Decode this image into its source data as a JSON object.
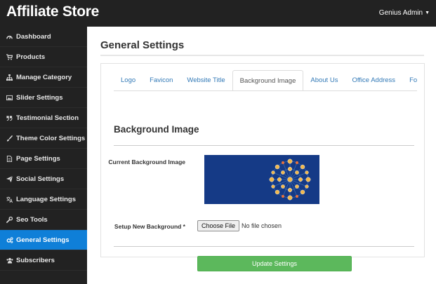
{
  "app": {
    "brand": "Affiliate Store",
    "user": "Genius Admin"
  },
  "sidebar": {
    "items": [
      {
        "label": "Dashboard",
        "icon": "dashboard-icon"
      },
      {
        "label": "Products",
        "icon": "cart-icon"
      },
      {
        "label": "Manage Category",
        "icon": "sitemap-icon"
      },
      {
        "label": "Slider Settings",
        "icon": "image-icon"
      },
      {
        "label": "Testimonial Section",
        "icon": "quote-icon"
      },
      {
        "label": "Theme Color Settings",
        "icon": "paint-brush-icon"
      },
      {
        "label": "Page Settings",
        "icon": "file-icon"
      },
      {
        "label": "Social Settings",
        "icon": "paper-plane-icon"
      },
      {
        "label": "Language Settings",
        "icon": "language-icon"
      },
      {
        "label": "Seo Tools",
        "icon": "wrench-icon"
      },
      {
        "label": "General Settings",
        "icon": "gears-icon",
        "active": true
      },
      {
        "label": "Subscribers",
        "icon": "users-icon"
      }
    ]
  },
  "main": {
    "title": "General Settings",
    "tabs": [
      {
        "label": "Logo"
      },
      {
        "label": "Favicon"
      },
      {
        "label": "Website Title"
      },
      {
        "label": "Background Image",
        "active": true
      },
      {
        "label": "About Us"
      },
      {
        "label": "Office Address"
      },
      {
        "label": "Footer"
      }
    ],
    "section_title": "Background Image",
    "current_bg_label": "Current Background Image",
    "new_bg_label": "Setup New Background *",
    "file_button": "Choose File",
    "file_status": "No file chosen",
    "update_button": "Update Settings"
  },
  "colors": {
    "sidebar_bg": "#222222",
    "active": "#0f7fd8",
    "success": "#5cb85c",
    "link": "#337ab7",
    "image_bg": "#153a86"
  }
}
